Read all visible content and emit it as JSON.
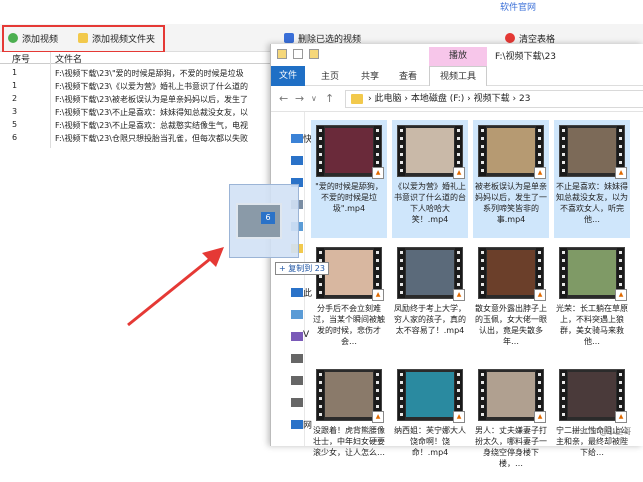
{
  "app": {
    "brand": "软件官网",
    "toolbar": {
      "add_video": "添加视频",
      "add_folder": "添加视频文件夹",
      "delete_selected": "删除已选的视频",
      "clear_table": "清空表格"
    },
    "table": {
      "col_index": "序号",
      "col_name": "文件名",
      "rows": [
        {
          "index": "1",
          "name": "F:\\视频下载\\23\\\"爱的时候是舔狗，不爱的时候是垃圾"
        },
        {
          "index": "1",
          "name": "F:\\视频下载\\23\\《以爱为营》婚礼上书意识了什么道的"
        },
        {
          "index": "2",
          "name": "F:\\视频下载\\23\\被老板误认为是单亲妈妈以后，发生了"
        },
        {
          "index": "3",
          "name": "F:\\视频下载\\23\\不止是喜欢：妹妹得知总裁没女友，以"
        },
        {
          "index": "5",
          "name": "F:\\视频下载\\23\\不止是喜欢：总裁憨实结像生气，电视"
        },
        {
          "index": "6",
          "name": "F:\\视频下载\\23\\仓限只想投胎当孔雀，但每次都以失败"
        }
      ]
    },
    "drag": {
      "badge": "6",
      "tooltip": "+ 复制到 23"
    }
  },
  "explorer": {
    "title_path": "F:\\视频下载\\23",
    "context_tab": "播放",
    "ribbon": {
      "file": "文件",
      "home": "主页",
      "share": "共享",
      "view": "查看",
      "video_tools": "视频工具"
    },
    "address": [
      "此电脑",
      "本地磁盘 (F:)",
      "视频下载",
      "23"
    ],
    "nav": [
      {
        "label": "快",
        "icon": "star-icon"
      },
      {
        "label": "",
        "icon": "desktop-icon"
      },
      {
        "label": "",
        "icon": "download-icon"
      },
      {
        "label": "",
        "icon": "document-icon"
      },
      {
        "label": "",
        "icon": "picture-icon"
      },
      {
        "label": "",
        "icon": "folder-icon"
      },
      {
        "label": "W",
        "icon": "cloud-icon"
      },
      {
        "label": "此",
        "icon": "pc-icon"
      },
      {
        "label": "",
        "icon": "objects-icon"
      },
      {
        "label": "V",
        "icon": "video-icon"
      },
      {
        "label": "",
        "icon": "drive-icon"
      },
      {
        "label": "",
        "icon": "drive-icon"
      },
      {
        "label": "",
        "icon": "drive-icon"
      },
      {
        "label": "网",
        "icon": "network-icon"
      }
    ],
    "files": [
      {
        "caption": "\"爱的时候是舔狗，不爱的时候是垃圾\".mp4",
        "selected": true,
        "color": "#6a2a3a"
      },
      {
        "caption": "《以爱为营》婚礼上书意识了什么道的台下人哈哈大笑！.mp4",
        "selected": true,
        "color": "#c9b9a8"
      },
      {
        "caption": "被老板误认为是单亲妈妈以后，发生了一系列啼笑皆非的事.mp4",
        "selected": true,
        "color": "#b69a72"
      },
      {
        "caption": "不止是喜欢：妹妹得知总裁没女友，以为不喜欢女人，听完他…",
        "selected": true,
        "color": "#7c6a58"
      },
      {
        "caption": "分手后不会立刻难过，当某个瞬间被触发的时候，悲伤才会…",
        "selected": false,
        "color": "#d8b7a0"
      },
      {
        "caption": "凤励终于考上大学，穷人家的孩子，真的太不容易了！.mp4",
        "selected": false,
        "color": "#5b6a7a"
      },
      {
        "caption": "散女意外露出脖子上的玉佩，女大佬一眼认出，竟是失散多年…",
        "selected": false,
        "color": "#6b3f2a"
      },
      {
        "caption": "光荣：长工躺在草原上，不料突遇上狼群，美女骑马来救他…",
        "selected": false,
        "color": "#7f9a66"
      },
      {
        "caption": "没跟着！虎背熊腰像壮士，中年妇女硬要滚少女，让人怎么…",
        "selected": false,
        "color": "#8a7a6a"
      },
      {
        "caption": "纳西姐：芙宁娜大人饶命啊！饶命！.mp4",
        "selected": false,
        "color": "#2a8aa0"
      },
      {
        "caption": "男人：丈夫嫌妻子打扮太久，哪料妻子一身绕空停身楼下楼，…",
        "selected": false,
        "color": "#b0a090"
      },
      {
        "caption": "宁二拼上性命阻止公主和亲，最终却被陛下给…",
        "selected": false,
        "color": "#4a3a3a"
      }
    ]
  },
  "watermark": "CSDN @小鱼哥",
  "colors": {
    "accent_red": "#e53935",
    "explorer_blue": "#1f6fc5",
    "selection": "#cfe6fb",
    "context_pink": "#f7c6ea"
  }
}
